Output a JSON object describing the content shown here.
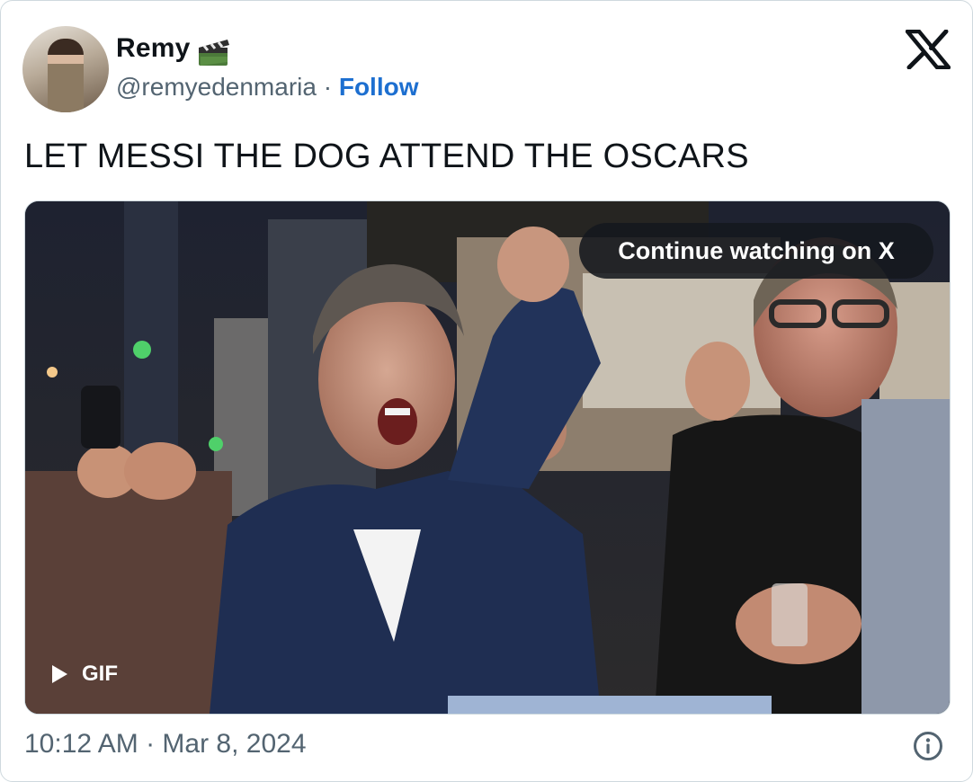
{
  "author": {
    "name": "Remy",
    "name_emoji_icon": "clapper-board-icon",
    "handle": "@remyedenmaria",
    "separator": "·",
    "follow_label": "Follow"
  },
  "brand": {
    "logo": "x-logo-icon"
  },
  "tweet": {
    "text": "LET MESSI THE DOG ATTEND THE OSCARS"
  },
  "media": {
    "continue_label": "Continue watching on X",
    "gif_label": "GIF",
    "play_icon": "play-icon"
  },
  "footer": {
    "timestamp": "10:12 AM · Mar 8, 2024",
    "info_icon": "info-icon"
  },
  "colors": {
    "follow": "#1d6fd0",
    "secondary_text": "#536471",
    "border": "#cfd9de"
  }
}
